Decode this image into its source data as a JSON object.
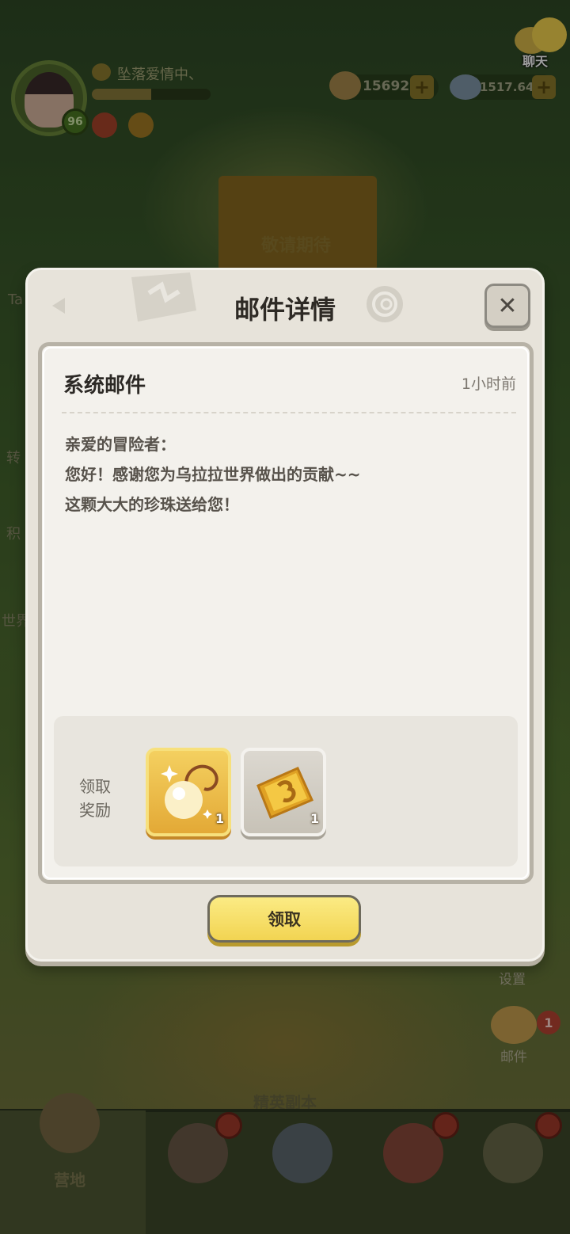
{
  "hud": {
    "player_name": "坠落爱情中、",
    "level": "96",
    "exp_progress": 0.5,
    "coins": "15692",
    "gems": "1517.64M",
    "chat_label": "聊天"
  },
  "background": {
    "banner_text": "敬请期待",
    "side_left_labels": [
      "Ta",
      "转",
      "积",
      "世界"
    ],
    "settings_label": "设置",
    "mail_label": "邮件",
    "mail_badge": "1",
    "elite_label": "精英副本",
    "nav_home_label": "营地"
  },
  "dialog": {
    "title": "邮件详情",
    "close_symbol": "✕",
    "mail": {
      "subject": "系统邮件",
      "time": "1小时前",
      "body": [
        "亲爱的冒险者：",
        "您好！感谢您为乌拉拉世界做出的贡献~~",
        "这颗大大的珍珠送给您！"
      ]
    },
    "rewards": {
      "label_line1": "领取",
      "label_line2": "奖励",
      "items": [
        {
          "icon": "pearl-necklace-icon",
          "qty": "1",
          "rarity": "gold"
        },
        {
          "icon": "gold-ticket-icon",
          "qty": "1",
          "rarity": "common"
        }
      ]
    },
    "claim_label": "领取"
  }
}
